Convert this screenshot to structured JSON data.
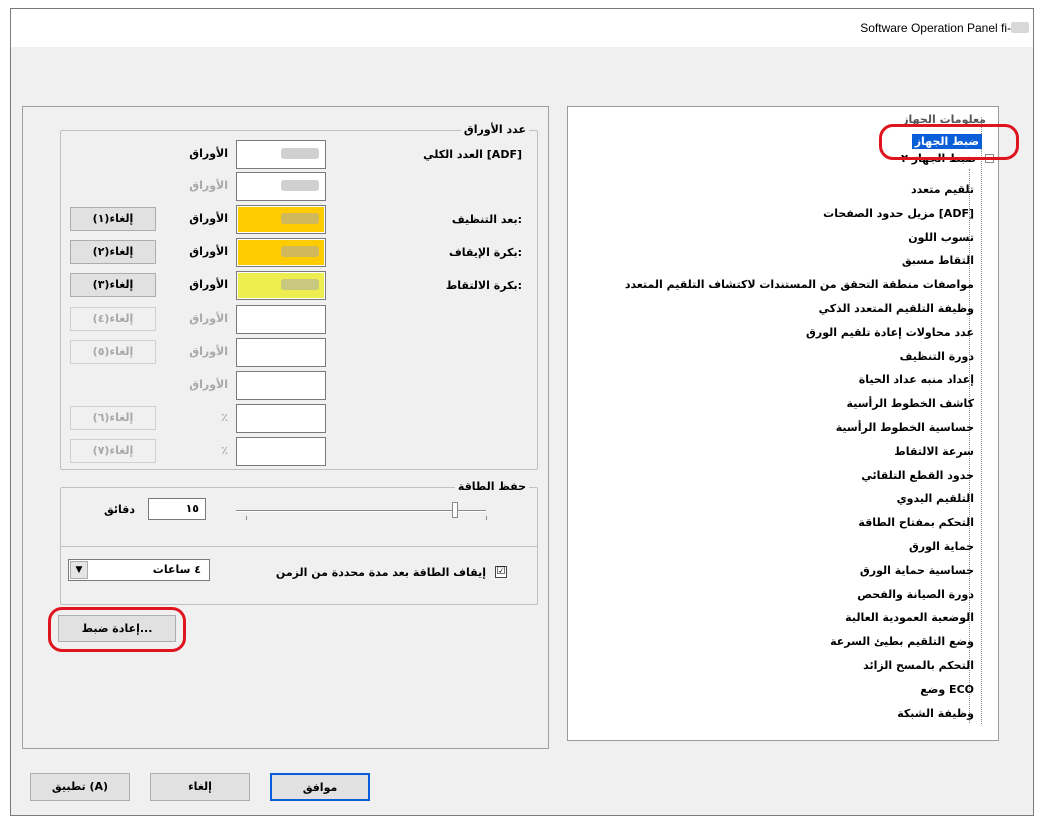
{
  "window": {
    "title": "Software Operation Panel fi-"
  },
  "tree": {
    "root_label": "معلومات الجهاز",
    "selected_label": "ضبط الجهاز",
    "sub_label": "ضبط الجهاز ٢",
    "items": [
      "تلقيم متعدد",
      "مزيل حدود الصفحات [ADF]",
      "تسوب اللون",
      "التقاط مسبق",
      "مواصفات منطقة التحقق من المستندات لاكتشاف التلقيم المتعدد",
      "وظيفة التلقيم المتعدد الذكي",
      "عدد محاولات إعادة تلقيم الورق",
      "دورة التنظيف",
      "إعداد منبه عداد الحياة",
      "كاشف الخطوط الرأسية",
      "حساسية الخطوط الرأسية",
      "سرعة الالتقاط",
      "حدود القطع التلقائي",
      "التلقيم اليدوي",
      "التحكم بمفتاح الطاقة",
      "حماية الورق",
      "حساسية حماية الورق",
      "دورة الصيانة والفحص",
      "الوضعية العمودية العالية",
      "وضع التلقيم بطيئ السرعة",
      "التحكم بالمسح الزائد",
      "وضع ECO",
      "وظيفة الشبكة"
    ]
  },
  "sheet_counter": {
    "title": "عدد الأوراق",
    "rows": [
      {
        "label": "العدد الكلي [ADF]",
        "unit": "الأوراق",
        "button": "",
        "dim": false,
        "fill": ""
      },
      {
        "label": "",
        "unit": "الأوراق",
        "button": "",
        "dim": true,
        "fill": ""
      },
      {
        "label": "بعد التنظيف:",
        "unit": "الأوراق",
        "button": "إلغاء(١)",
        "dim": false,
        "fill": "#ffcc00"
      },
      {
        "label": "بكرة الإيقاف:",
        "unit": "الأوراق",
        "button": "إلغاء(٢)",
        "dim": false,
        "fill": "#ffcc00"
      },
      {
        "label": "بكرة الالتقاط:",
        "unit": "الأوراق",
        "button": "إلغاء(٣)",
        "dim": false,
        "fill": "#eded50"
      },
      {
        "label": "",
        "unit": "الأوراق",
        "button": "إلغاء(٤)",
        "dim": true,
        "fill": ""
      },
      {
        "label": "",
        "unit": "الأوراق",
        "button": "إلغاء(٥)",
        "dim": true,
        "fill": ""
      },
      {
        "label": "",
        "unit": "الأوراق",
        "button": "",
        "dim": true,
        "fill": ""
      },
      {
        "label": "",
        "unit": "٪",
        "button": "إلغاء(٦)",
        "dim": true,
        "fill": ""
      },
      {
        "label": "",
        "unit": "٪",
        "button": "إلغاء(٧)",
        "dim": true,
        "fill": ""
      }
    ]
  },
  "power_saving": {
    "title": "حفظ الطاقة",
    "minutes_value": "١٥",
    "minutes_unit": "دقائق",
    "auto_off_label": "إيقاف الطاقة بعد مدة محددة من الزمن",
    "auto_off_checked": "☑",
    "hours_value": "٤ ساعات",
    "dropdown_arrow": "▼"
  },
  "reset_button": "إعادة ضبط...",
  "buttons": {
    "ok": "موافق",
    "cancel": "إلغاء",
    "apply": "تطبيق (A)"
  }
}
